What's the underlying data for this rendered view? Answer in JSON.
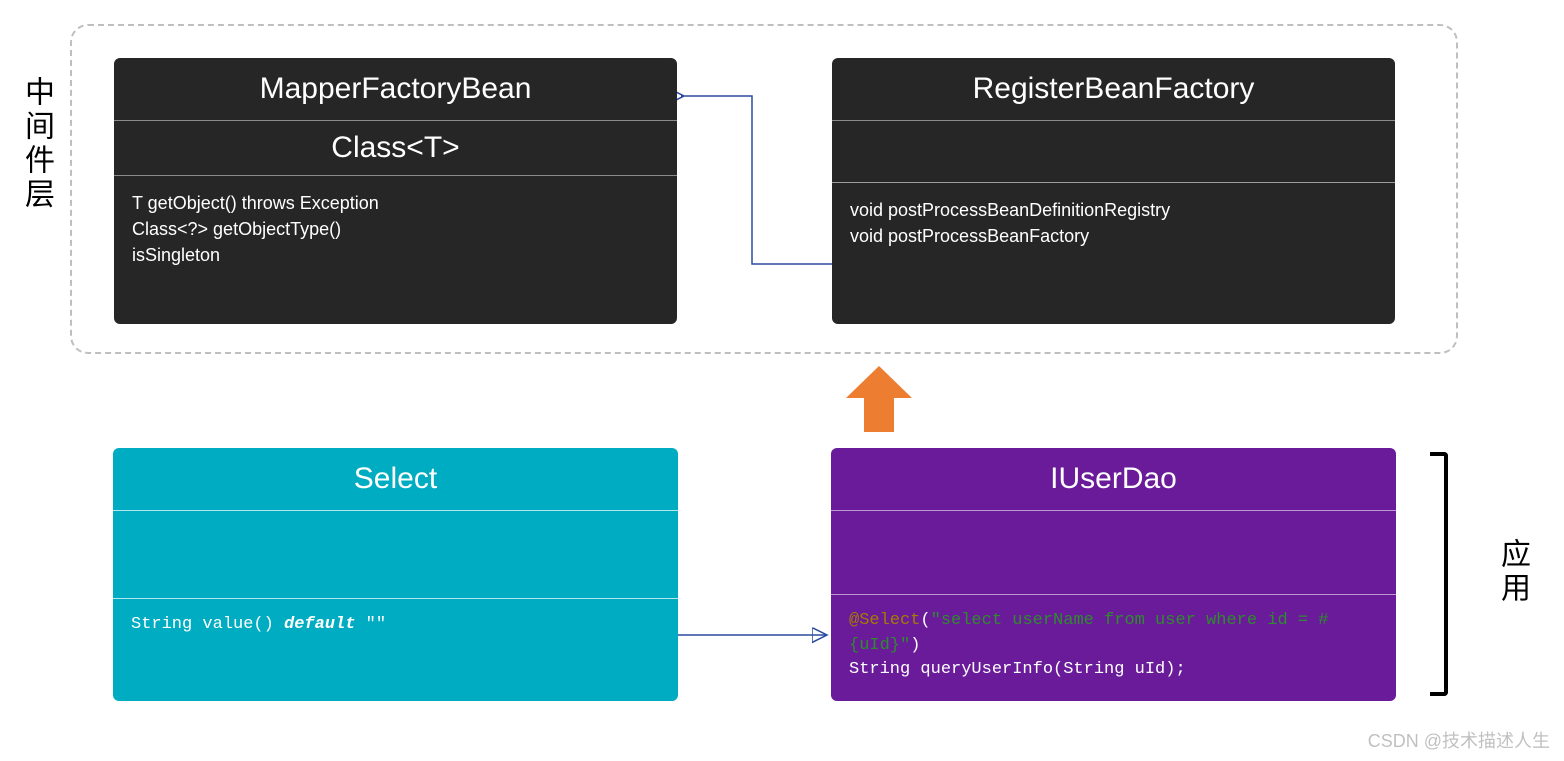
{
  "labels": {
    "middleware_layer": "中间件层",
    "application_layer": "应用"
  },
  "boxes": {
    "mapperFactoryBean": {
      "title": "MapperFactoryBean",
      "subtitle": "Class<T>",
      "methods": [
        "T getObject() throws Exception",
        "Class<?> getObjectType()",
        "isSingleton"
      ]
    },
    "registerBeanFactory": {
      "title": "RegisterBeanFactory",
      "methods": [
        "void postProcessBeanDefinitionRegistry",
        "void postProcessBeanFactory"
      ]
    },
    "select": {
      "title": "Select",
      "code": {
        "prefix": "String value() ",
        "keyword": "default",
        "suffix": " \"\""
      }
    },
    "iUserDao": {
      "title": "IUserDao",
      "code": {
        "annotation": "@Select",
        "paren_open": "(",
        "string": "\"select userName from user where id = #{uId}\"",
        "paren_close": ")",
        "line2": "String queryUserInfo(String uId);"
      }
    }
  },
  "watermark": "CSDN @技术描述人生"
}
